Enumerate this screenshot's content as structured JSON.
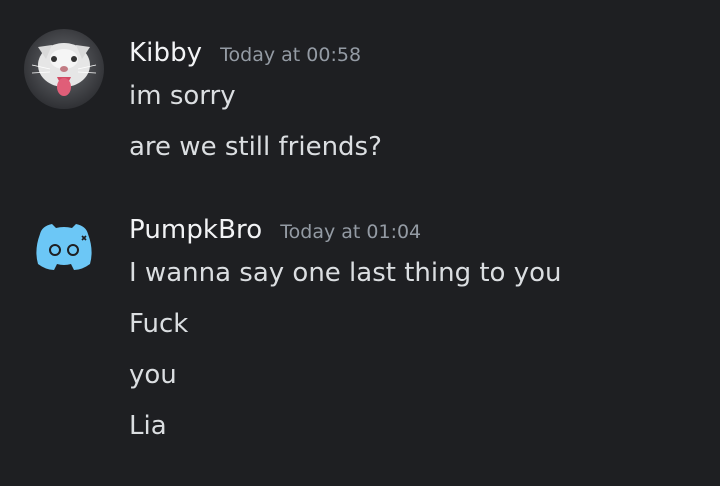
{
  "messages": [
    {
      "username": "Kibby",
      "timestamp": "Today at 00:58",
      "avatar_icon": "cat-avatar-icon",
      "lines": [
        "im sorry",
        "are we still friends?"
      ]
    },
    {
      "username": "PumpkBro",
      "timestamp": "Today at 01:04",
      "avatar_icon": "discord-logo-icon",
      "avatar_color": "#6cc7f6",
      "lines": [
        "I wanna say one last thing to you",
        "Fuck",
        "you",
        "Lia"
      ]
    }
  ],
  "colors": {
    "background": "#1e1f22",
    "username": "#f2f3f5",
    "message_text": "#dbdee1",
    "timestamp": "#949ba4"
  }
}
